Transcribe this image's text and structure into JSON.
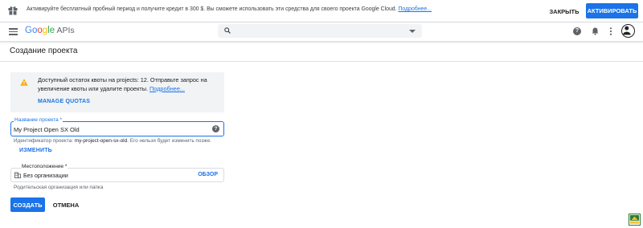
{
  "banner": {
    "text": "Активируйте бесплатный пробный период и получите кредит в 300 $. Вы сможете использовать эти средства для своего проекта Google Cloud.",
    "link": "Подробнее...",
    "close_label": "ЗАКРЫТЬ",
    "activate_label": "АКТИВИРОВАТЬ"
  },
  "topbar": {
    "logo": {
      "g1": "Go",
      "g2": "o",
      "g3": "g",
      "g4": "le",
      "apis": " APIs"
    },
    "search_placeholder": "",
    "icons": [
      "menu-icon",
      "search-icon",
      "help-icon",
      "bell-icon",
      "more-vert-icon"
    ]
  },
  "page": {
    "title": "Создание проекта"
  },
  "quota": {
    "text": "Доступный остаток квоты на projects: 12. Отправьте запрос на увеличение квоты или удалите проекты.",
    "link": "Подробнее...",
    "manage_label": "MANAGE QUOTAS"
  },
  "form": {
    "name_label": "Название проекта *",
    "name_value": "My Project Open SX Old",
    "id_prefix": "Идентификатор проекта: ",
    "id_value": "my-project-open-sx-old",
    "id_suffix": ". Его нельзя будет изменить позже.",
    "change_label": "ИЗМЕНИТЬ",
    "location_label": "Местоположение *",
    "location_value": "Без организации",
    "browse_label": "ОБЗОР",
    "location_hint": "Родительская организация или папка",
    "create_label": "СОЗДАТЬ",
    "cancel_label": "ОТМЕНА"
  },
  "colors": {
    "accent": "#1a73e8",
    "warning": "#f9ab00",
    "panel": "#f1f3f4"
  }
}
